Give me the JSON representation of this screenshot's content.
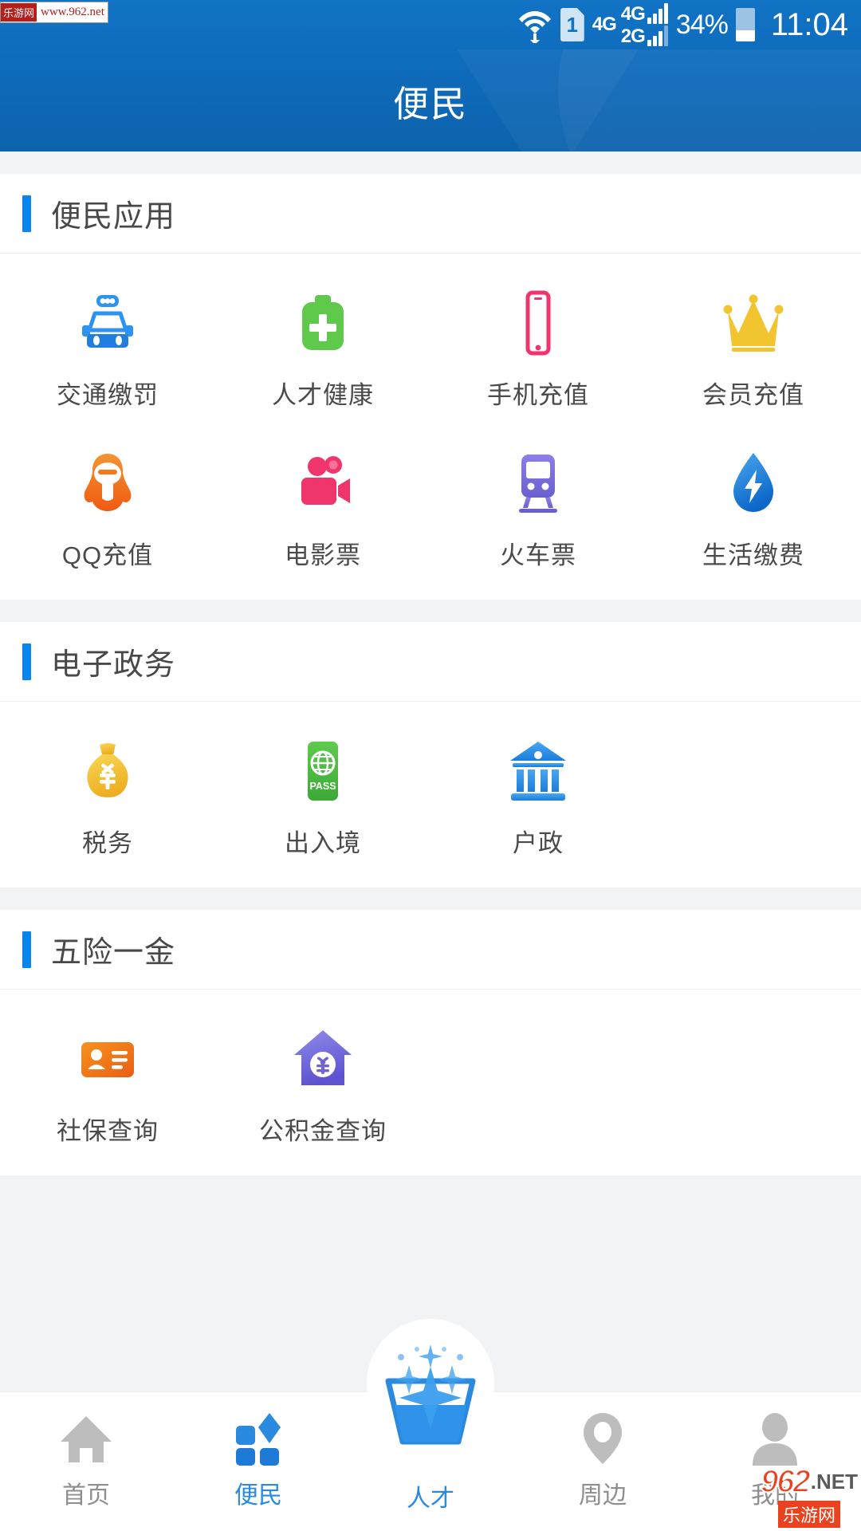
{
  "watermarks": {
    "top_left_badge": "乐游网",
    "top_left_url": "www.962.net",
    "bottom_right_main": "962",
    "bottom_right_tld": ".NET",
    "bottom_right_sub": "乐游网"
  },
  "status_bar": {
    "sim_slot": "1",
    "net_primary": "4G",
    "net_secondary_top": "4G",
    "net_secondary_bottom": "2G",
    "battery_percent": "34%",
    "battery_level": 34,
    "time": "11:04",
    "icons": [
      "wifi-icon",
      "sim-card-icon",
      "signal-bars-icon",
      "battery-icon"
    ]
  },
  "app_bar": {
    "title": "便民"
  },
  "sections": [
    {
      "title": "便民应用",
      "accent": "#0a84ef",
      "items": [
        {
          "label": "交通缴罚",
          "icon": "police-car-icon",
          "color": "#2d93f0"
        },
        {
          "label": "人才健康",
          "icon": "medical-kit-icon",
          "color": "#5ec94a"
        },
        {
          "label": "手机充值",
          "icon": "mobile-phone-icon",
          "color": "#f0356d"
        },
        {
          "label": "会员充值",
          "icon": "crown-icon",
          "color": "#f2c430"
        },
        {
          "label": "QQ充值",
          "icon": "qq-penguin-icon",
          "color": "#f07a20"
        },
        {
          "label": "电影票",
          "icon": "movie-camera-icon",
          "color": "#f0356d"
        },
        {
          "label": "火车票",
          "icon": "train-icon",
          "color": "#6f6fd8"
        },
        {
          "label": "生活缴费",
          "icon": "water-drop-bolt-icon",
          "color": "#1e90e8"
        }
      ]
    },
    {
      "title": "电子政务",
      "accent": "#0a84ef",
      "items": [
        {
          "label": "税务",
          "icon": "money-bag-icon",
          "color": "#f0c133"
        },
        {
          "label": "出入境",
          "icon": "passport-pass-icon",
          "color": "#4bbd43"
        },
        {
          "label": "户政",
          "icon": "bank-building-icon",
          "color": "#2d93f0"
        }
      ]
    },
    {
      "title": "五险一金",
      "accent": "#0a84ef",
      "items": [
        {
          "label": "社保查询",
          "icon": "id-card-icon",
          "color": "#ef7a18"
        },
        {
          "label": "公积金查询",
          "icon": "house-yuan-icon",
          "color": "#6f6fd8"
        }
      ]
    }
  ],
  "tab_bar": {
    "active_index": 1,
    "active_color": "#2a8ae0",
    "inactive_color": "#b5b5b5",
    "items": [
      {
        "label": "首页",
        "icon": "home-icon",
        "active": false
      },
      {
        "label": "便民",
        "icon": "grid-apps-icon",
        "active": true
      },
      {
        "label": "人才",
        "icon": "talent-sparkle-icon",
        "active": true
      },
      {
        "label": "周边",
        "icon": "location-pin-icon",
        "active": false
      },
      {
        "label": "我的",
        "icon": "person-icon",
        "active": false
      }
    ]
  }
}
